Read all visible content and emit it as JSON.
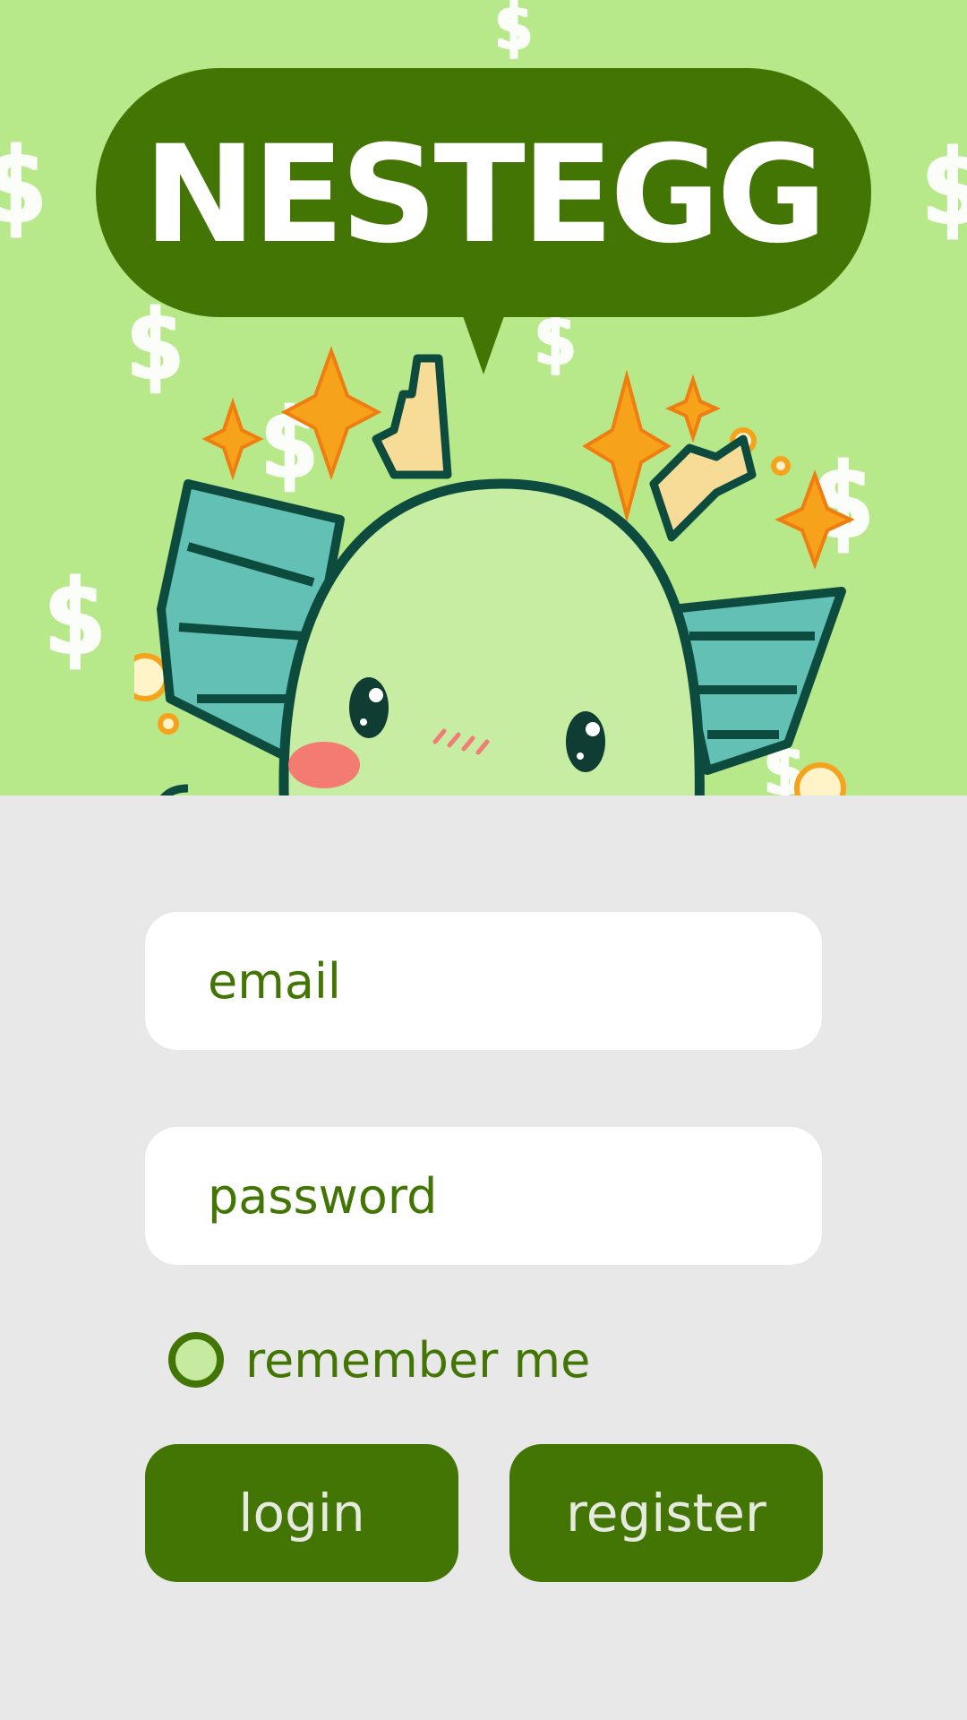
{
  "app": {
    "title": "NESTEGG"
  },
  "hero": {
    "background_color": "#b7e889",
    "decoration_symbol": "$",
    "mascot": "green-dragon-mascot"
  },
  "form": {
    "email": {
      "placeholder": "email",
      "value": ""
    },
    "password": {
      "placeholder": "password",
      "value": ""
    },
    "remember_me": {
      "label": "remember me",
      "checked": false
    },
    "buttons": {
      "login_label": "login",
      "register_label": "register"
    }
  },
  "colors": {
    "brand_green": "#437505",
    "page_background": "#e8e8e8",
    "button_text": "#e6eadf"
  }
}
